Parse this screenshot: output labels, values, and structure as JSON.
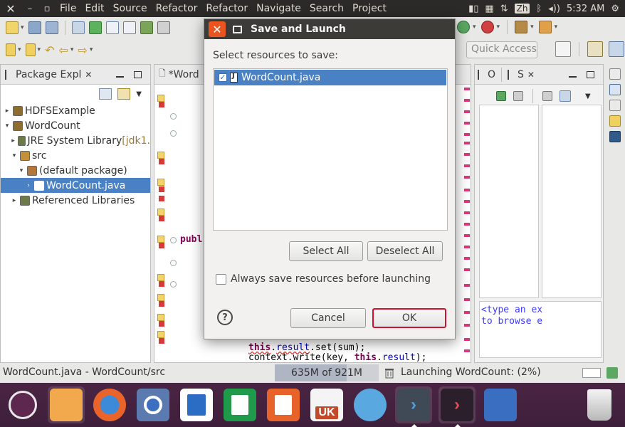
{
  "topbar": {
    "menus": [
      "File",
      "Edit",
      "Source",
      "Refactor",
      "Refactor",
      "Navigate",
      "Search",
      "Project"
    ],
    "input_method": "Zh",
    "clock": "5:32 AM"
  },
  "toolbar": {
    "quick_access_placeholder": "Quick Access"
  },
  "package_explorer": {
    "tab_label": "Package Expl",
    "tree": [
      {
        "label": "HDFSExample",
        "suffix": "",
        "indent": 0,
        "twisty": "▸",
        "icon": "project-icon",
        "color": "#8e6e2f"
      },
      {
        "label": "WordCount",
        "suffix": "",
        "indent": 0,
        "twisty": "▾",
        "icon": "project-icon",
        "color": "#8e6e2f"
      },
      {
        "label": "JRE System Library ",
        "suffix": "[jdk1.",
        "indent": 1,
        "twisty": "▸",
        "icon": "library-icon",
        "color": "#6c7a4a"
      },
      {
        "label": "src",
        "suffix": "",
        "indent": 1,
        "twisty": "▾",
        "icon": "source-folder-icon",
        "color": "#c4913a"
      },
      {
        "label": "(default package)",
        "suffix": "",
        "indent": 2,
        "twisty": "▾",
        "icon": "package-icon",
        "color": "#b2773a"
      },
      {
        "label": "WordCount.java",
        "suffix": "",
        "indent": 3,
        "twisty": "›",
        "icon": "java-file-icon",
        "color": "#ffffff",
        "selected": true
      },
      {
        "label": "Referenced Libraries",
        "suffix": "",
        "indent": 1,
        "twisty": "▸",
        "icon": "library-icon",
        "color": "#6c7a4a"
      }
    ]
  },
  "editor": {
    "tab_label": "*Word",
    "code_line_public": "publ",
    "code_line_1": "this.result.set(sum);",
    "code_line_2": "context.write(key, this.result);",
    "kw_this": "this",
    "fld_result": "result",
    "line1_rest": ".set(sum);",
    "line2_pre": "context.write(key, ",
    "line2_rest": ");"
  },
  "outline": {
    "tab1_label": "O",
    "tab2_label": "S",
    "tip_line1": "<type an ex",
    "tip_line2": "to browse e"
  },
  "status": {
    "path": "WordCount.java - WordCount/src",
    "heap": "635M of 921M",
    "heap_used_fraction": 0.69,
    "launch": "Launching WordCount: (2%)"
  },
  "dialog": {
    "title": "Save and Launch",
    "prompt": "Select resources to save:",
    "resource": "WordCount.java",
    "select_all": "Select All",
    "deselect_all": "Deselect All",
    "always_save": "Always save resources before launching",
    "help": "?",
    "cancel": "Cancel",
    "ok": "OK"
  },
  "dock": {
    "uk_label": "UK"
  },
  "colors": {
    "selection": "#4a80c4",
    "ok_highlight": "#d1102b",
    "dialog_close": "#e9541f",
    "dock_bg": "#3e1f3b"
  }
}
